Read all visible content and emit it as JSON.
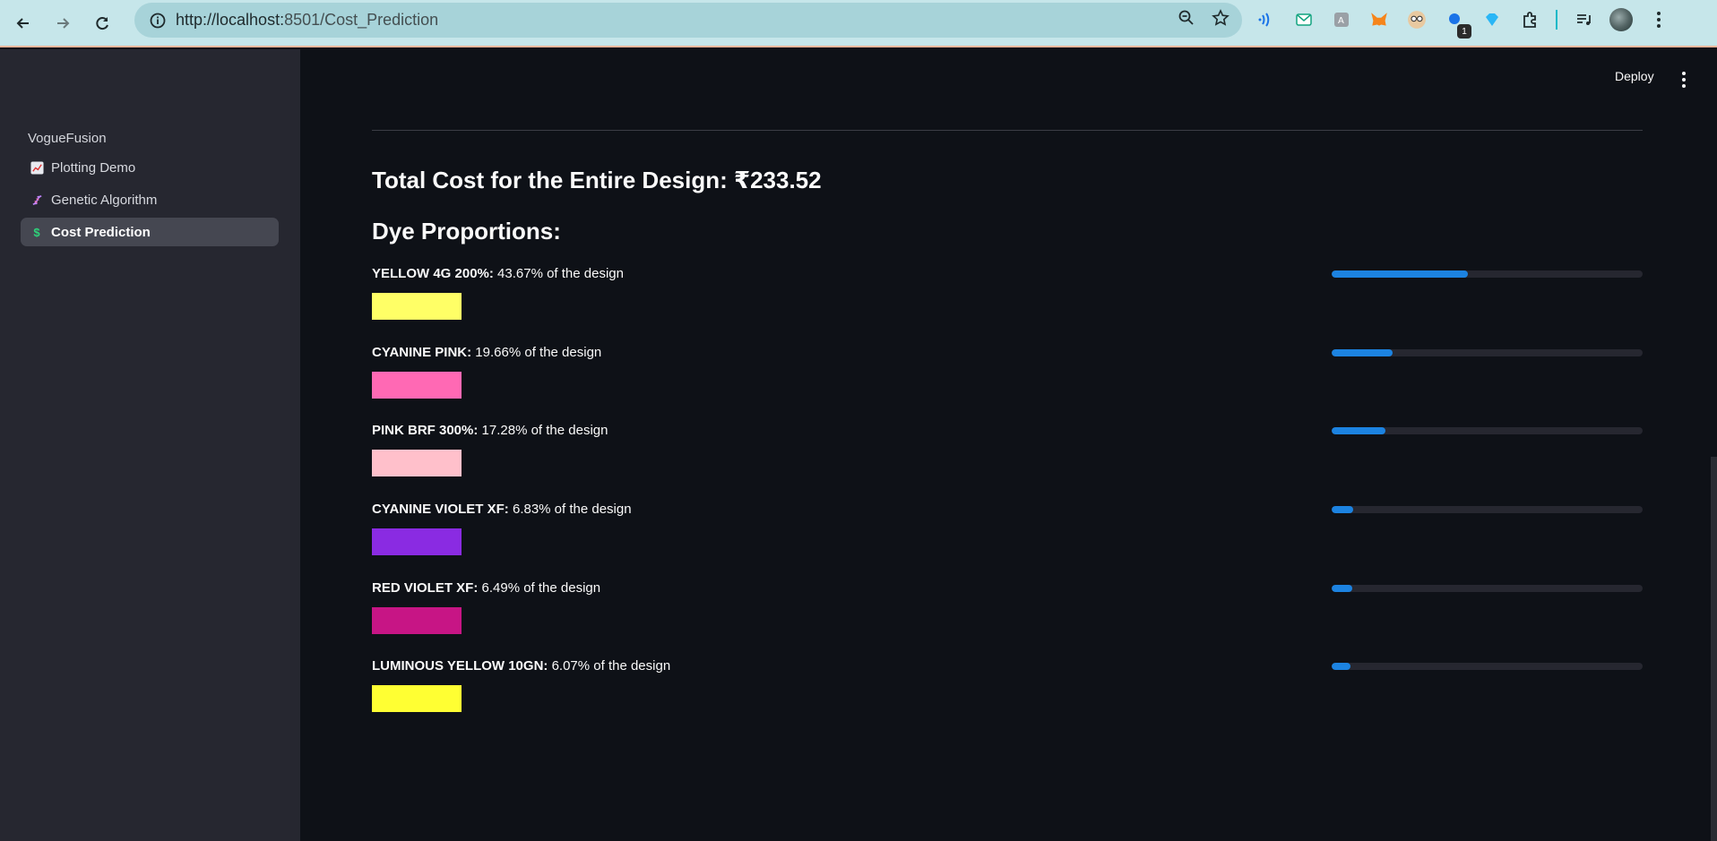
{
  "browser": {
    "url_host": "http://localhost:",
    "url_rest": "8501/Cost_Prediction",
    "extension_badge": "1"
  },
  "sidebar": {
    "heading": "VogueFusion",
    "items": [
      {
        "label": "Plotting Demo",
        "icon": "chart-icon",
        "active": false
      },
      {
        "label": "Genetic Algorithm",
        "icon": "dna-icon",
        "active": false
      },
      {
        "label": "Cost Prediction",
        "icon": "dollar-icon",
        "active": true
      }
    ]
  },
  "header": {
    "deploy_label": "Deploy"
  },
  "main": {
    "total_cost": "Total Cost for the Entire Design: ₹233.52",
    "dye_heading": "Dye Proportions:",
    "dyes": [
      {
        "name": "YELLOW 4G 200%:",
        "text": " 43.67% of the design",
        "percent": 43.67,
        "color": "#ffff66"
      },
      {
        "name": "CYANINE PINK:",
        "text": " 19.66% of the design",
        "percent": 19.66,
        "color": "#ff69b4"
      },
      {
        "name": "PINK BRF 300%:",
        "text": " 17.28% of the design",
        "percent": 17.28,
        "color": "#ffc0cb"
      },
      {
        "name": "CYANINE VIOLET XF:",
        "text": " 6.83% of the design",
        "percent": 6.83,
        "color": "#8a2be2"
      },
      {
        "name": "RED VIOLET XF:",
        "text": " 6.49% of the design",
        "percent": 6.49,
        "color": "#c71585"
      },
      {
        "name": "LUMINOUS YELLOW 10GN:",
        "text": " 6.07% of the design",
        "percent": 6.07,
        "color": "#ffff33"
      }
    ]
  },
  "colors": {
    "accent": "#1c83e1",
    "sidebar_bg": "#262730",
    "main_bg": "#0e1117"
  }
}
